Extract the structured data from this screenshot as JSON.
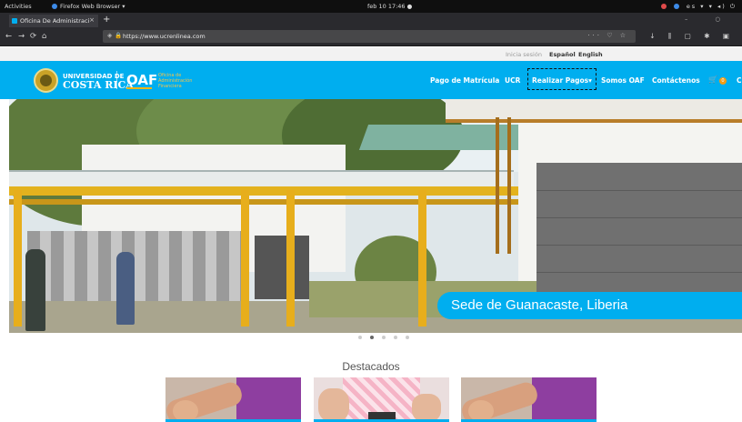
{
  "system_bar": {
    "activities": "Activities",
    "app_name": "Firefox Web Browser ▾",
    "clock": "feb 10  17:46  ●",
    "tray": "es ▾"
  },
  "browser": {
    "tab_title": "Oficina De Administraci",
    "tab_close": "×",
    "new_tab": "+",
    "window_controls": "– ○",
    "url": "https://www.ucrenlinea.com",
    "url_actions": "··· ♡ ☆",
    "nav_icons": {
      "back": "←",
      "forward": "→",
      "reload": "⟳",
      "home": "⌂"
    },
    "toolbar_icons": "↓ ⫼ ▢ ✱ ▣"
  },
  "util_bar": {
    "login": "Inicia sesión",
    "lang_es": "Español",
    "lang_en": "English"
  },
  "header": {
    "university_line1": "UNIVERSIDAD DE",
    "university_line2": "COSTA RICA",
    "oaf": "OAF",
    "oaf_sub": [
      "Oficina de",
      "Administración",
      "Financiera"
    ],
    "menu": [
      {
        "label": "Pago de Matrícula"
      },
      {
        "label": "UCR"
      },
      {
        "label": "Realizar Pagos"
      },
      {
        "label": "Somos OAF"
      },
      {
        "label": "Contáctenos"
      }
    ],
    "cart_count": "0",
    "menu_more": "C"
  },
  "hero": {
    "caption": "Sede de Guanacaste, Liberia",
    "slides": 5,
    "active_slide": 2
  },
  "featured": {
    "title": "Destacados"
  },
  "colors": {
    "brand_blue": "#00aeef",
    "accent_yellow": "#f6b614"
  }
}
